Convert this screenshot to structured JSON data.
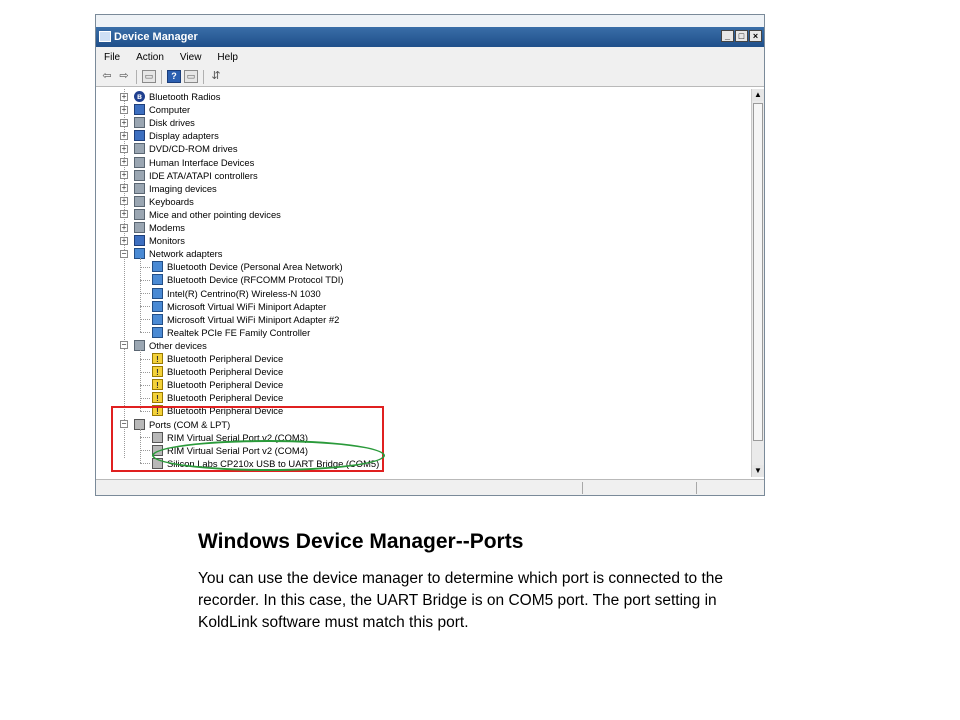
{
  "window": {
    "title": "Device Manager",
    "minimize": "_",
    "maximize": "□",
    "close": "×"
  },
  "menu": [
    "File",
    "Action",
    "View",
    "Help"
  ],
  "toolbar": {
    "back": "⇦",
    "forward": "⇨",
    "properties": "▭",
    "help": "?",
    "scan": "▭",
    "update": "⇵"
  },
  "tree": {
    "categories": [
      {
        "label": "Bluetooth Radios",
        "icon": "bluetooth-icon",
        "expanded": false
      },
      {
        "label": "Computer",
        "icon": "computer-icon",
        "expanded": false
      },
      {
        "label": "Disk drives",
        "icon": "disk-drive-icon",
        "expanded": false
      },
      {
        "label": "Display adapters",
        "icon": "display-adapter-icon",
        "expanded": false
      },
      {
        "label": "DVD/CD-ROM drives",
        "icon": "dvd-drive-icon",
        "expanded": false
      },
      {
        "label": "Human Interface Devices",
        "icon": "hid-icon",
        "expanded": false
      },
      {
        "label": "IDE ATA/ATAPI controllers",
        "icon": "ide-controller-icon",
        "expanded": false
      },
      {
        "label": "Imaging devices",
        "icon": "camera-icon",
        "expanded": false
      },
      {
        "label": "Keyboards",
        "icon": "keyboard-icon",
        "expanded": false
      },
      {
        "label": "Mice and other pointing devices",
        "icon": "mouse-icon",
        "expanded": false
      },
      {
        "label": "Modems",
        "icon": "modem-icon",
        "expanded": false
      },
      {
        "label": "Monitors",
        "icon": "monitor-icon",
        "expanded": false
      },
      {
        "label": "Network adapters",
        "icon": "network-adapter-icon",
        "expanded": true,
        "children": [
          "Bluetooth Device (Personal Area Network)",
          "Bluetooth Device (RFCOMM Protocol TDI)",
          "Intel(R) Centrino(R) Wireless-N 1030",
          "Microsoft Virtual WiFi Miniport Adapter",
          "Microsoft Virtual WiFi Miniport Adapter #2",
          "Realtek PCIe FE Family Controller"
        ]
      },
      {
        "label": "Other devices",
        "icon": "unknown-device-icon",
        "expanded": true,
        "children": [
          "Bluetooth Peripheral Device",
          "Bluetooth Peripheral Device",
          "Bluetooth Peripheral Device",
          "Bluetooth Peripheral Device",
          "Bluetooth Peripheral Device"
        ]
      },
      {
        "label": "Ports (COM & LPT)",
        "icon": "port-icon",
        "expanded": true,
        "children": [
          "RIM Virtual Serial Port v2 (COM3)",
          "RIM Virtual Serial Port v2 (COM4)",
          "Silicon Labs CP210x USB to UART Bridge (COM5)"
        ]
      }
    ]
  },
  "slide": {
    "title": "Windows Device Manager--Ports",
    "body": "You can use the device manager to determine which port is connected to the recorder.   In this case, the UART Bridge is on COM5 port.  The port setting in KoldLink software must match this port."
  },
  "colors": {
    "highlight_box": "#e02020",
    "highlight_ellipse": "#2a9a3a",
    "titlebar": "#2a5d99"
  }
}
